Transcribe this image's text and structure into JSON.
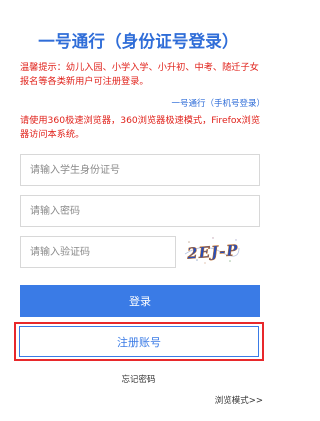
{
  "page": {
    "title": "一号通行（身份证号登录）",
    "notice": "温馨提示：幼儿入园、小学入学、小升初、中考、随迁子女报名等各类新用户可注册登录。",
    "alt_login_link": "一号通行（手机号登录）",
    "browser_notice": "请使用360极速浏览器，360浏览器极速模式，Firefox浏览器访问本系统。"
  },
  "form": {
    "id_placeholder": "请输入学生身份证号",
    "password_placeholder": "请输入密码",
    "captcha_placeholder": "请输入验证码",
    "captcha_text": "2EJ-P",
    "login_label": "登录",
    "register_label": "注册账号",
    "forgot_label": "忘记密码",
    "browse_mode_label": "浏览模式>>"
  },
  "colors": {
    "accent": "#3a7be6",
    "title": "#2f6dd8",
    "notice": "#e0221b",
    "highlight_frame": "#e8282b"
  }
}
